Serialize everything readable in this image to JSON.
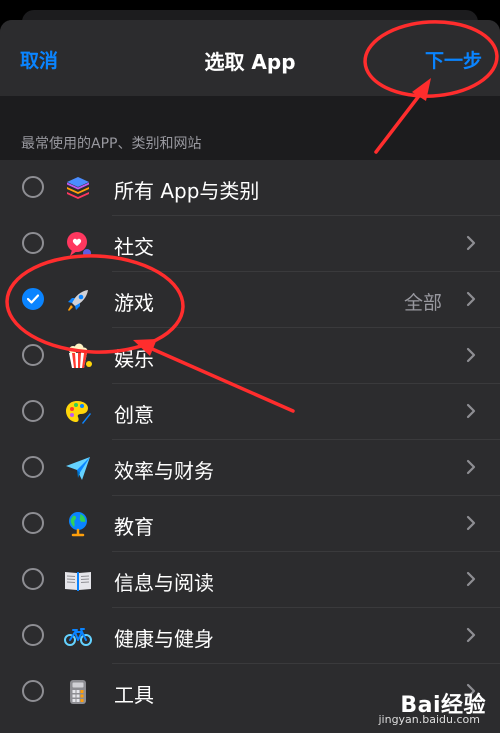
{
  "nav": {
    "cancel_label": "取消",
    "title": "选取 App",
    "next_label": "下一步"
  },
  "section": {
    "header": "最常使用的APP、类别和网站"
  },
  "rows": [
    {
      "label": "所有 App与类别",
      "icon": "stack-icon",
      "checked": false,
      "detail": "",
      "chevron": false
    },
    {
      "label": "社交",
      "icon": "chat-heart-icon",
      "checked": false,
      "detail": "",
      "chevron": true
    },
    {
      "label": "游戏",
      "icon": "rocket-icon",
      "checked": true,
      "detail": "全部",
      "chevron": true
    },
    {
      "label": "娱乐",
      "icon": "popcorn-icon",
      "checked": false,
      "detail": "",
      "chevron": true
    },
    {
      "label": "创意",
      "icon": "palette-icon",
      "checked": false,
      "detail": "",
      "chevron": true
    },
    {
      "label": "效率与财务",
      "icon": "paper-plane-icon",
      "checked": false,
      "detail": "",
      "chevron": true
    },
    {
      "label": "教育",
      "icon": "globe-icon",
      "checked": false,
      "detail": "",
      "chevron": true
    },
    {
      "label": "信息与阅读",
      "icon": "book-icon",
      "checked": false,
      "detail": "",
      "chevron": true
    },
    {
      "label": "健康与健身",
      "icon": "bicycle-icon",
      "checked": false,
      "detail": "",
      "chevron": true
    },
    {
      "label": "工具",
      "icon": "calculator-icon",
      "checked": false,
      "detail": "",
      "chevron": true
    }
  ],
  "colors": {
    "accent": "#0a84ff",
    "annotation": "#ff2d2d",
    "sheet_bg": "#2c2c2e",
    "section_bg": "#1c1c1e"
  },
  "watermark": {
    "main": "Bai经验",
    "sub": "jingyan.baidu.com"
  }
}
